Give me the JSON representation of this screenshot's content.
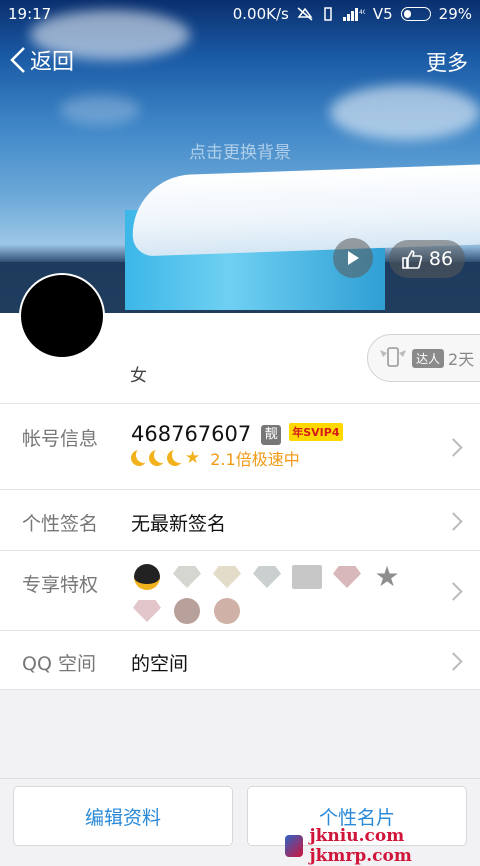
{
  "status_bar": {
    "time": "19:17",
    "speed": "0.00K/s",
    "carrier": "V5",
    "battery": "29%"
  },
  "header": {
    "back_label": "返回",
    "more_label": "更多",
    "change_bg_hint": "点击更换背景"
  },
  "cover_actions": {
    "like_count": "86"
  },
  "profile": {
    "gender": "女",
    "talent_badge": "达人",
    "talent_days": "2天"
  },
  "rows": {
    "account": {
      "label": "帐号信息",
      "number": "468767607",
      "liang": "靓",
      "svip": "年SVIP4",
      "speed_text": "2.1倍极速中"
    },
    "signature": {
      "label": "个性签名",
      "value": "无最新签名"
    },
    "privileges": {
      "label": "专享特权"
    },
    "qzone": {
      "label": "QQ 空间",
      "value": "的空间"
    }
  },
  "bottom": {
    "edit_profile": "编辑资料",
    "business_card": "个性名片"
  },
  "watermark": {
    "text": "jkniu.com jkmrp.com"
  },
  "colors": {
    "accent": "#2b8ad8",
    "vip_gold": "#f19a16"
  }
}
